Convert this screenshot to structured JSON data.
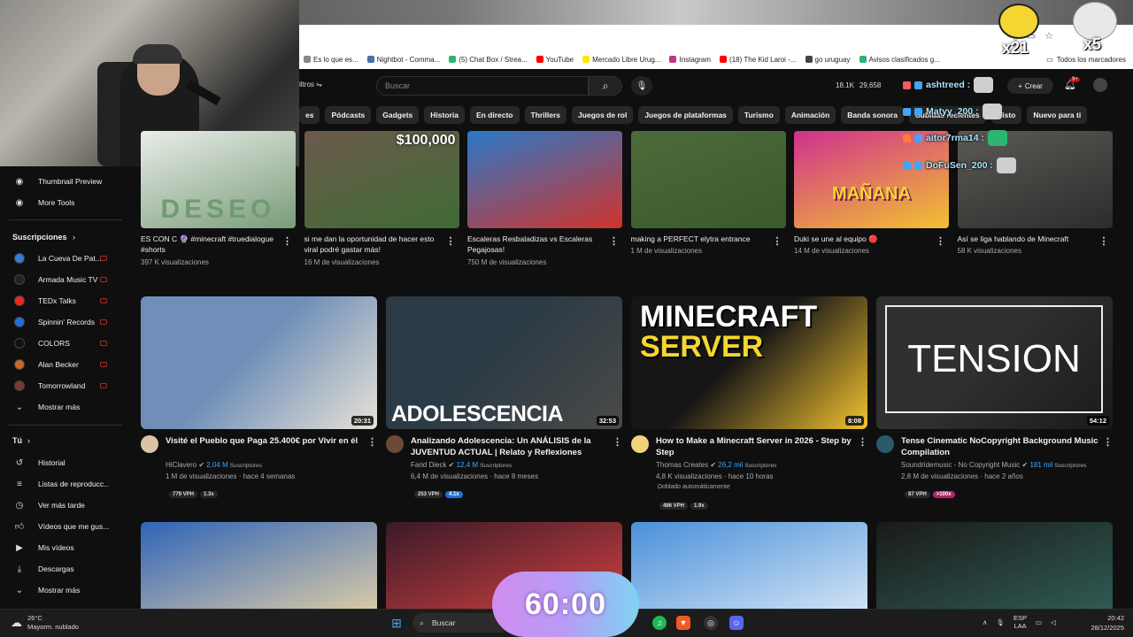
{
  "bookmarks": [
    {
      "label": "Es lo que es...",
      "color": "#888"
    },
    {
      "label": "Nightbot - Comma...",
      "color": "#4a6ea9"
    },
    {
      "label": "(5) Chat Box / Strea...",
      "color": "#2bb673"
    },
    {
      "label": "YouTube",
      "color": "#ff0000"
    },
    {
      "label": "Mercado Libre Urug...",
      "color": "#ffe600"
    },
    {
      "label": "Instagram",
      "color": "#c13584"
    },
    {
      "label": "(18) The Kid Laroi -...",
      "color": "#ff0000"
    },
    {
      "label": "go uruguay",
      "color": "#444"
    },
    {
      "label": "Avisos clasificados g...",
      "color": "#2bb673"
    }
  ],
  "bookmarks_right": "Todos los marcadores",
  "topbar": {
    "filters": "iltros",
    "search_placeholder": "Buscar",
    "stat1": "18.1K",
    "stat2": "29,658",
    "create": "Crear",
    "bell_badge": "9+"
  },
  "chips": [
    "es",
    "Pódcasts",
    "Gadgets",
    "Historia",
    "En directo",
    "Thrillers",
    "Juegos de rol",
    "Juegos de plataformas",
    "Turismo",
    "Animación",
    "Banda sonora",
    "Subidas recientes",
    "Visto",
    "Nuevo para ti"
  ],
  "sidebar": {
    "tools": [
      "Thumbnail Preview",
      "More Tools"
    ],
    "subs_heading": "Suscripciones",
    "subs": [
      {
        "label": "La Cueva De Pat...",
        "color": "#3a7bd5"
      },
      {
        "label": "Armada Music TV",
        "color": "#222"
      },
      {
        "label": "TEDx Talks",
        "color": "#e62b1e"
      },
      {
        "label": "Spinnin' Records",
        "color": "#1f6fd6"
      },
      {
        "label": "COLORS",
        "color": "#111"
      },
      {
        "label": "Alan Becker",
        "color": "#c76a2a"
      },
      {
        "label": "Tomorrowland",
        "color": "#7a3b2e"
      }
    ],
    "show_more": "Mostrar más",
    "you_heading": "Tú",
    "you_items": [
      "Historial",
      "Listas de reproducc...",
      "Ver más tarde",
      "Vídeos que me gus...",
      "Mis vídeos",
      "Descargas",
      "Mostrar más"
    ]
  },
  "shorts": [
    {
      "title": "ES CON C 🔮 #minecraft #truedialogue #shorts",
      "views": "397 K visualizaciones",
      "thumb_text": "DESEO",
      "bg": "#e9ede8",
      "accent": "#7a9c7a"
    },
    {
      "title": "si me dan la oportunidad de hacer esto viral podré gastar más!",
      "views": "16 M de visualizaciones",
      "thumb_text": "$100,000",
      "bg": "#6b5a4b",
      "accent": "#3f6b35"
    },
    {
      "title": "Escaleras Resbaladizas vs Escaleras Pegajosas!",
      "views": "750 M de visualizaciones",
      "thumb_text": "",
      "bg": "#2a78c8",
      "accent": "#d0342c"
    },
    {
      "title": "making a PERFECT elytra entrance",
      "views": "1 M de visualizaciones",
      "thumb_text": "",
      "bg": "#4d6b3a",
      "accent": "#3a5a2a"
    },
    {
      "title": "Duki se une al equipo 🔴",
      "views": "14 M de visualizaciones",
      "thumb_text": "MAÑANA",
      "bg": "#d0308f",
      "accent": "#f2c230"
    },
    {
      "title": "Así se liga hablando de Minecraft",
      "views": "58 K visualizaciones",
      "thumb_text": "",
      "bg": "#5c5a55",
      "accent": "#2c2c2c"
    }
  ],
  "videos": [
    {
      "title": "Visité el Pueblo que Paga 25.400€ por Vivir en él",
      "channel": "HiClavero",
      "subs": "2,04 M",
      "subs_label": "Suscriptores",
      "meta": "1 M de visualizaciones · hace 4 semanas",
      "duration": "20:31",
      "vph": "779 VPH",
      "mult": "1.3x",
      "mult_style": "",
      "extra": "",
      "thumb_text": "",
      "bg1": "#6f8fb8",
      "bg2": "#e8e2d6",
      "avatar": "#d9c4a8"
    },
    {
      "title": "Analizando Adolescencia: Un ANÁLISIS de la JUVENTUD ACTUAL | Relato y Reflexiones",
      "channel": "Farid Dieck",
      "subs": "12,4 M",
      "subs_label": "Suscriptores",
      "meta": "6,4 M de visualizaciones · hace 8 meses",
      "duration": "32:53",
      "vph": "253 VPH",
      "mult": "4.1x",
      "mult_style": "blue",
      "extra": "",
      "thumb_text": "ADOLESCENCIA",
      "bg1": "#2c3b45",
      "bg2": "#4a4a48",
      "avatar": "#6b4a3a"
    },
    {
      "title": "How to Make a Minecraft Server in 2026 - Step by Step",
      "channel": "Thomas Creates",
      "subs": "26,2 mil",
      "subs_label": "Suscriptores",
      "meta": "4,8 K visualizaciones · hace 10 horas",
      "duration": "8:08",
      "vph": "486 VPH",
      "mult": "1.9x",
      "mult_style": "",
      "extra": "Doblado automáticamente",
      "thumb_text": "MINECRAFT SERVER",
      "bg1": "#161616",
      "bg2": "#f2c230",
      "avatar": "#f2d27a"
    },
    {
      "title": "Tense Cinematic NoCopyright Background Music Compilation",
      "channel": "Soundridemusic - No Copyright Music",
      "subs": "181 mil",
      "subs_label": "Suscriptores",
      "meta": "2,8 M de visualizaciones · hace 2 años",
      "duration": "54:12",
      "vph": "87 VPH",
      "mult": ">100x",
      "mult_style": "pink",
      "extra": "",
      "thumb_text": "TENSION",
      "bg1": "#303030",
      "bg2": "#1a1a1a",
      "avatar": "#2a5a6a"
    }
  ],
  "row3": [
    {
      "bg1": "#2f64b8",
      "bg2": "#d8c9a8"
    },
    {
      "bg1": "#3a1a28",
      "bg2": "#d04040"
    },
    {
      "bg1": "#4a90d9",
      "bg2": "#cfe2f5"
    },
    {
      "bg1": "#1a1a1a",
      "bg2": "#2f5a52"
    }
  ],
  "chat": [
    {
      "user": "ashtreed :",
      "color": "#ff5a5a"
    },
    {
      "user": "Matyy_200 :",
      "color": "#3ea6ff"
    },
    {
      "user": "aitor7rma14 :",
      "color": "#ff7a3a"
    },
    {
      "user": "DoFuSen_200 :",
      "color": "#3ea6ff"
    }
  ],
  "stickers": {
    "left_count": "x21",
    "right_count": "x5"
  },
  "timer": "60:00",
  "taskbar": {
    "temp": "26°C",
    "weather": "Mayorm. nublado",
    "search": "Buscar",
    "lang1": "ESP",
    "lang2": "LAA",
    "time": "20:42",
    "date": "28/12/2025"
  }
}
